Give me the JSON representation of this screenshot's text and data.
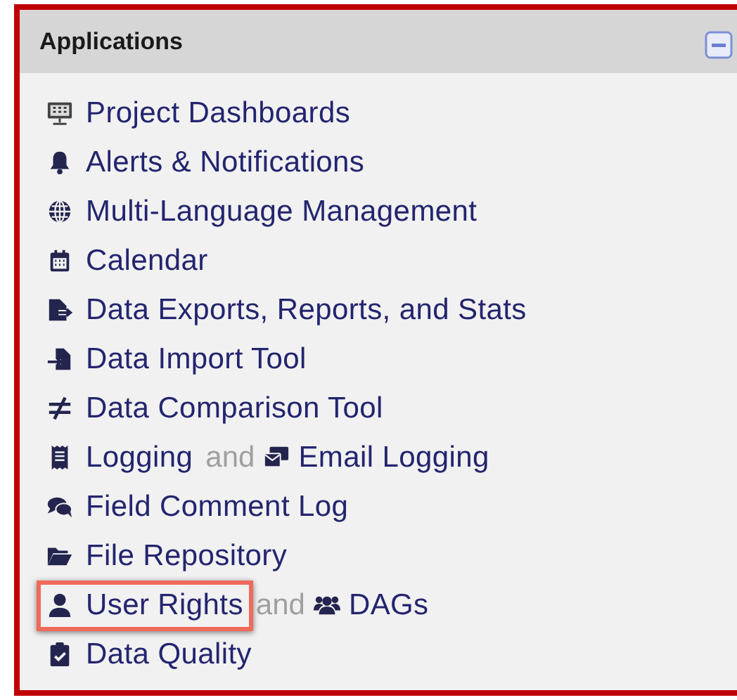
{
  "panel": {
    "title": "Applications",
    "expanded": true
  },
  "items": [
    {
      "kind": "dashboard",
      "label": "Project Dashboards",
      "highlighted": false
    },
    {
      "kind": "bell",
      "label": "Alerts & Notifications",
      "highlighted": false
    },
    {
      "kind": "globe",
      "label": "Multi-Language Management",
      "highlighted": false
    },
    {
      "kind": "calendar",
      "label": "Calendar",
      "highlighted": false
    },
    {
      "kind": "export",
      "label": "Data Exports, Reports, and Stats",
      "highlighted": false
    },
    {
      "kind": "import",
      "label": "Data Import Tool",
      "highlighted": false
    },
    {
      "kind": "notequal",
      "label": "Data Comparison Tool",
      "highlighted": false
    },
    {
      "kind": "receipt",
      "label": "Logging",
      "highlighted": false,
      "extra": {
        "joiner": "and",
        "kind": "mail",
        "label": "Email Logging"
      }
    },
    {
      "kind": "comments",
      "label": "Field Comment Log",
      "highlighted": false
    },
    {
      "kind": "folder",
      "label": "File Repository",
      "highlighted": false
    },
    {
      "kind": "user",
      "label": "User Rights",
      "highlighted": true,
      "extra": {
        "joiner": "and",
        "kind": "users",
        "label": "DAGs"
      }
    },
    {
      "kind": "clipboard",
      "label": "Data Quality",
      "highlighted": false
    }
  ]
}
